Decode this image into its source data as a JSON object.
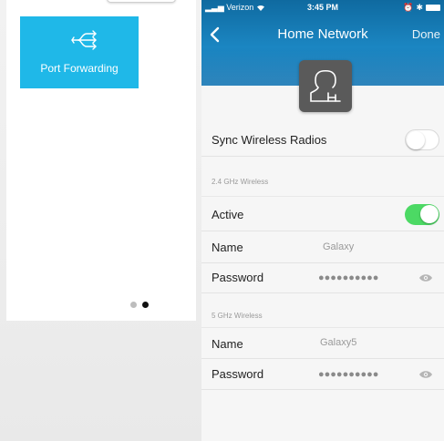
{
  "left_panel": {
    "tile_label": "Port Forwarding",
    "tile_icon": "port-forwarding-icon",
    "pagination": {
      "pages": 2,
      "active": 2
    }
  },
  "status_bar": {
    "carrier": "Verizon",
    "time": "3:45 PM"
  },
  "nav": {
    "title": "Home Network",
    "done_label": "Done"
  },
  "settings": {
    "sync_label": "Sync Wireless Radios",
    "sync_on": false,
    "band_24": {
      "section_label": "2.4 GHz Wireless",
      "active_label": "Active",
      "active_on": true,
      "name_label": "Name",
      "name_value": "Galaxy",
      "password_label": "Password",
      "password_value": "●●●●●●●●●●"
    },
    "band_5": {
      "section_label": "5 GHz Wireless",
      "name_label": "Name",
      "name_value": "Galaxy5",
      "password_label": "Password",
      "password_value": "●●●●●●●●●●"
    }
  },
  "colors": {
    "tile": "#1fb8e8",
    "header": "#1b86c2",
    "toggle_on": "#4cd964"
  }
}
